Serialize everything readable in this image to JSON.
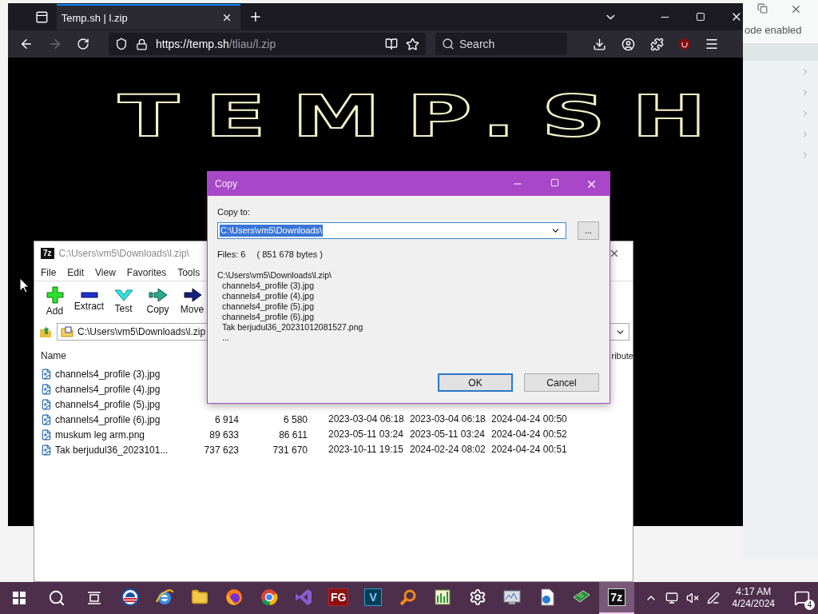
{
  "background_window": {
    "status": "ode enabled"
  },
  "browser": {
    "tab_title": "Temp.sh | l.zip",
    "url_host": "https://temp.sh",
    "url_path": "/tliau/l.zip",
    "search_placeholder": "Search",
    "logo": "TEMP.SH",
    "forward_disabled": true
  },
  "archiver": {
    "title": "C:\\Users\\vm5\\Downloads\\l.zip\\",
    "app_mark": "7z",
    "menu": [
      "File",
      "Edit",
      "View",
      "Favorites",
      "Tools"
    ],
    "toolbar": [
      {
        "kind": "add",
        "label": "Add"
      },
      {
        "kind": "extract",
        "label": "Extract"
      },
      {
        "kind": "test",
        "label": "Test"
      },
      {
        "kind": "copy",
        "label": "Copy"
      },
      {
        "kind": "move",
        "label": "Move"
      }
    ],
    "address": "C:\\Users\\vm5\\Downloads\\l.zip",
    "columns": [
      "Name",
      "ribute"
    ],
    "rows": [
      {
        "name": "channels4_profile (3).jpg"
      },
      {
        "name": "channels4_profile (4).jpg"
      },
      {
        "name": "channels4_profile (5).jpg"
      },
      {
        "name": "channels4_profile (6).jpg",
        "size": "6 914",
        "packed": "6 580",
        "modified": "2023-03-04 06:18",
        "created": "2023-03-04 06:18",
        "accessed": "2024-04-24 00:50"
      },
      {
        "name": "muskum leg arm.png",
        "size": "89 633",
        "packed": "86 611",
        "modified": "2023-05-11 03:24",
        "created": "2023-05-11 03:24",
        "accessed": "2024-04-24 00:52"
      },
      {
        "name": "Tak berjudul36_2023101...",
        "size": "737 623",
        "packed": "731 670",
        "modified": "2023-10-11 19:15",
        "created": "2024-02-24 08:02",
        "accessed": "2024-04-24 00:51"
      }
    ]
  },
  "copy_dialog": {
    "title": "Copy",
    "label": "Copy to:",
    "path": "C:\\Users\\vm5\\Downloads\\",
    "browse": "...",
    "files": "Files: 6",
    "bytes": "( 851 678 bytes )",
    "listing": {
      "archive": "C:\\Users\\vm5\\Downloads\\l.zip\\",
      "items": [
        "channels4_profile (3).jpg",
        "channels4_profile (4).jpg",
        "channels4_profile (5).jpg",
        "channels4_profile (6).jpg",
        "Tak berjudul36_20231012081527.png",
        "..."
      ]
    },
    "buttons": [
      {
        "label": "OK",
        "selected": true
      },
      {
        "label": "Cancel",
        "selected": false
      }
    ]
  },
  "taskbar": {
    "apps": [
      {
        "kind": "round-logo",
        "selected": false
      },
      {
        "kind": "globe",
        "selected": false
      },
      {
        "kind": "folder",
        "selected": false
      },
      {
        "kind": "fox",
        "selected": false
      },
      {
        "kind": "wheel",
        "selected": false
      },
      {
        "kind": "ribbon",
        "selected": false
      },
      {
        "kind": "tile",
        "label": "FG",
        "selected": false
      },
      {
        "kind": "tile",
        "label": "V",
        "selected": false
      },
      {
        "kind": "magnifier",
        "selected": false
      },
      {
        "kind": "chart",
        "selected": false
      },
      {
        "kind": "gear",
        "selected": false
      },
      {
        "kind": "monitor",
        "selected": false
      },
      {
        "kind": "document",
        "selected": false
      },
      {
        "kind": "board",
        "selected": false
      },
      {
        "kind": "tile",
        "label": "7z",
        "selected": true
      }
    ],
    "time": "4:17 AM",
    "date": "4/24/2024",
    "notifications": "4"
  }
}
